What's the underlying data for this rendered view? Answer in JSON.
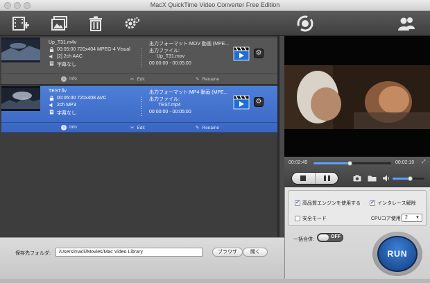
{
  "window": {
    "title": "MacX QuickTime Video Converter Free Edition"
  },
  "toolbar": {
    "add_video": "add-video-icon",
    "add_photo": "add-photo-icon",
    "delete": "trash-icon",
    "settings": "gear-icon",
    "update": "update-icon",
    "account": "users-icon"
  },
  "files": [
    {
      "name": "Up_T31.m4v",
      "duration_info": "00:05:00 720x404 MPEG-4 Visual",
      "audio": "[2] 2ch AAC",
      "subtitle": "字幕なし",
      "output_format": "出力フォーマット:MOV 動画 (MPE...",
      "output_file_label": "出力ファイル:",
      "output_file": "Up_T31.mov",
      "trim": "00:00:00 - 00:05:00",
      "info": "Info",
      "edit": "Edit",
      "rename": "Rename",
      "selected": false
    },
    {
      "name": "TEST.flv",
      "duration_info": "00:05:00 720x408 AVC",
      "audio": "2ch MP3",
      "subtitle": "字幕なし",
      "output_format": "出力フォーマット:MP4 動画 (MPE...",
      "output_file_label": "出力ファイル:",
      "output_file": "TEST.mp4",
      "trim": "00:00:00 - 00:05:00",
      "info": "Info",
      "edit": "Edit",
      "rename": "Rename",
      "selected": true
    }
  ],
  "output": {
    "label": "保存先フォルダ:",
    "path": "/Users/macli/Movies/Mac Video Library",
    "browse": "ブラウザ",
    "open": "開く"
  },
  "player": {
    "elapsed": "00:02:49",
    "total": "00:02:10",
    "progress": 0.46,
    "volume": 0.55
  },
  "settings": {
    "hq_engine": "高品質エンジンを使用する",
    "hq_engine_checked": true,
    "deinterlace": "インタレース解除",
    "deinterlace_checked": true,
    "safe_mode": "安全モード",
    "safe_mode_checked": false,
    "cpu_label": "CPUコア使用：",
    "cpu_value": "2",
    "merge_label": "一括合併:",
    "merge_toggle": "OFF",
    "run": "RUN"
  },
  "colors": {
    "selection": "#3f6fd0",
    "run_button": "#1b4f9a"
  }
}
